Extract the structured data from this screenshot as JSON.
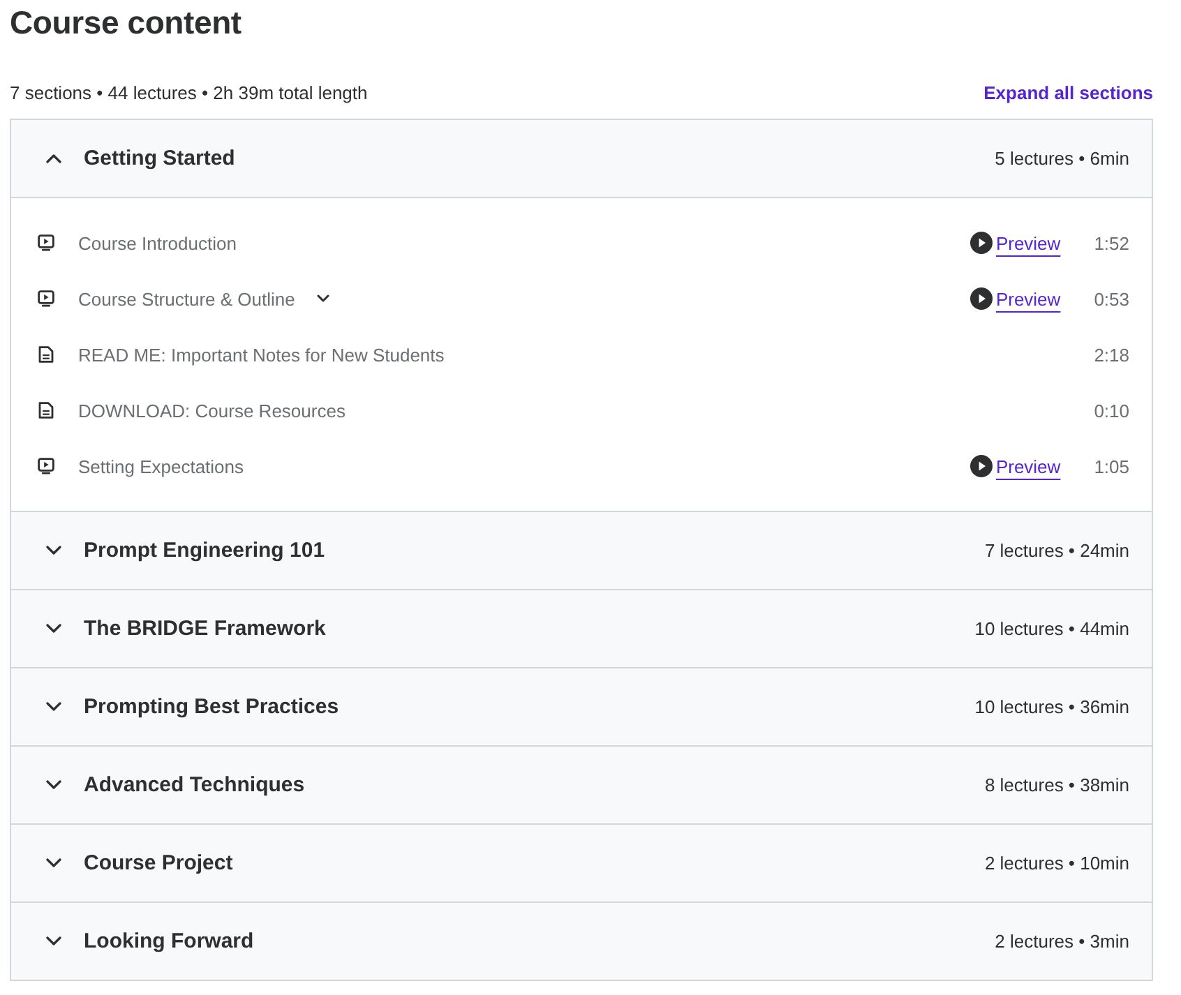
{
  "title": "Course content",
  "summary": "7 sections • 44 lectures • 2h 39m total length",
  "expand_all": "Expand all sections",
  "sections": [
    {
      "title": "Getting Started",
      "meta": "5 lectures • 6min",
      "expanded": true,
      "lectures": [
        {
          "kind": "video",
          "title": "Course Introduction",
          "preview": "Preview",
          "duration": "1:52"
        },
        {
          "kind": "video",
          "title": "Course Structure & Outline",
          "description": {
            "expanded": false
          },
          "preview": "Preview",
          "duration": "0:53"
        },
        {
          "kind": "article",
          "title": "READ ME: Important Notes for New Students",
          "duration": "2:18"
        },
        {
          "kind": "article",
          "title": "DOWNLOAD: Course Resources",
          "duration": "0:10"
        },
        {
          "kind": "video",
          "title": "Setting Expectations",
          "preview": "Preview",
          "duration": "1:05"
        }
      ]
    },
    {
      "title": "Prompt Engineering 101",
      "meta": "7 lectures • 24min",
      "expanded": false
    },
    {
      "title": "The BRIDGE Framework",
      "meta": "10 lectures • 44min",
      "expanded": false
    },
    {
      "title": "Prompting Best Practices",
      "meta": "10 lectures • 36min",
      "expanded": false
    },
    {
      "title": "Advanced Techniques",
      "meta": "8 lectures • 38min",
      "expanded": false
    },
    {
      "title": "Course Project",
      "meta": "2 lectures • 10min",
      "expanded": false
    },
    {
      "title": "Looking Forward",
      "meta": "2 lectures • 3min",
      "expanded": false
    }
  ]
}
